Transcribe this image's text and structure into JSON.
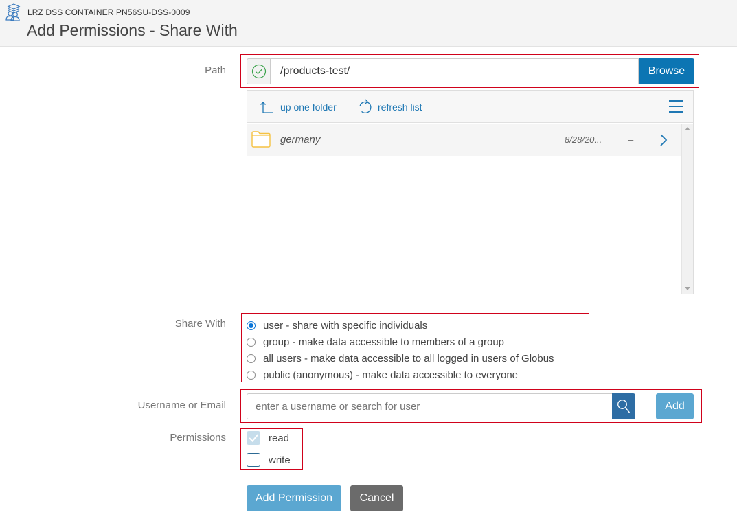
{
  "header": {
    "logo_icon": "shared-collection-icon",
    "collection_name": "LRZ DSS CONTAINER PN56SU-DSS-0009",
    "page_title": "Add Permissions - Share With"
  },
  "path": {
    "label": "Path",
    "status_icon": "check-circle-icon",
    "value": "/products-test/",
    "browse_label": "Browse"
  },
  "browser": {
    "up_label": "up one folder",
    "refresh_label": "refresh list",
    "menu_icon": "hamburger-menu-icon",
    "items": [
      {
        "name": "germany",
        "type": "folder",
        "date": "8/28/20...",
        "size": "–"
      }
    ]
  },
  "share_with": {
    "label": "Share With",
    "options": [
      {
        "label": "user - share with specific individuals",
        "selected": true
      },
      {
        "label": "group - make data accessible to members of a group",
        "selected": false
      },
      {
        "label": "all users - make data accessible to all logged in users of Globus",
        "selected": false
      },
      {
        "label": "public (anonymous) - make data accessible to everyone",
        "selected": false
      }
    ]
  },
  "username": {
    "label": "Username or Email",
    "placeholder": "enter a username or search for user",
    "value": "",
    "add_label": "Add"
  },
  "permissions": {
    "label": "Permissions",
    "read": {
      "label": "read",
      "checked": true,
      "disabled": true
    },
    "write": {
      "label": "write",
      "checked": false,
      "disabled": false
    }
  },
  "actions": {
    "submit_label": "Add Permission",
    "cancel_label": "Cancel"
  },
  "colors": {
    "primary": "#0c75b3",
    "primary_light": "#5ba7d1",
    "highlight_border": "#d0021b",
    "folder": "#f5c242"
  }
}
